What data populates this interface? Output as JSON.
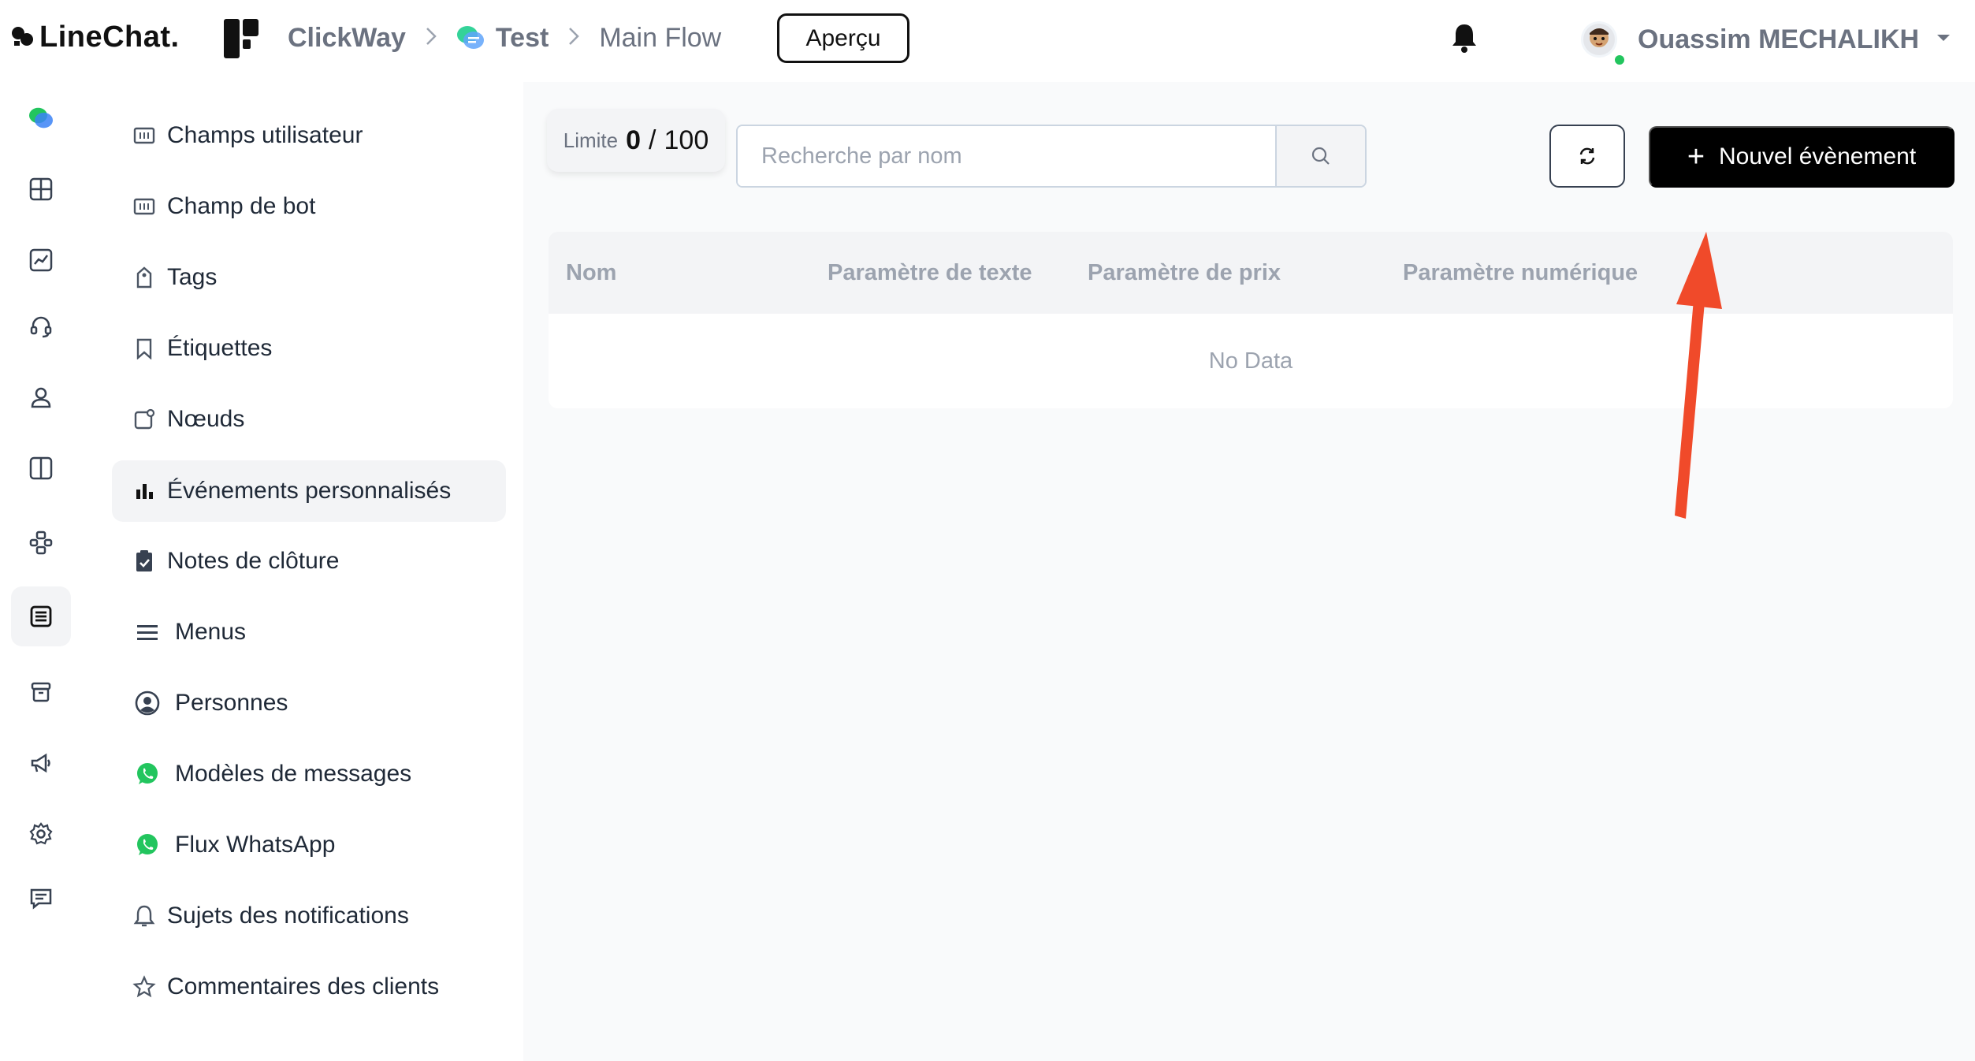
{
  "brand": {
    "name": "LineChat."
  },
  "breadcrumb": {
    "workspace": "ClickWay",
    "bot": "Test",
    "flow": "Main Flow",
    "separator": ">"
  },
  "header": {
    "preview_label": "Aperçu",
    "user_name": "Ouassim MECHALIKH",
    "user_status_color": "#22c55e"
  },
  "rail": {
    "items": [
      "chat-bubbles-icon",
      "dashboard-grid-icon",
      "analytics-chart-icon",
      "headset-icon",
      "user-icon",
      "columns-icon",
      "flow-nodes-icon",
      "content-list-icon",
      "archive-icon",
      "megaphone-icon",
      "settings-icon",
      "message-icon"
    ],
    "active_index": 7
  },
  "sidebar": {
    "items": [
      {
        "label": "Champs utilisateur",
        "icon": "field-icon"
      },
      {
        "label": "Champ de bot",
        "icon": "field-icon"
      },
      {
        "label": "Tags",
        "icon": "tag-icon"
      },
      {
        "label": "Étiquettes",
        "icon": "bookmark-icon"
      },
      {
        "label": "Nœuds",
        "icon": "node-icon"
      },
      {
        "label": "Événements personnalisés",
        "icon": "bar-chart-icon",
        "active": true
      },
      {
        "label": "Notes de clôture",
        "icon": "clipboard-check-icon"
      },
      {
        "label": "Menus",
        "icon": "menu-lines-icon"
      },
      {
        "label": "Personnes",
        "icon": "person-circle-icon"
      },
      {
        "label": "Modèles de messages",
        "icon": "whatsapp-icon"
      },
      {
        "label": "Flux WhatsApp",
        "icon": "whatsapp-icon"
      },
      {
        "label": "Sujets des notifications",
        "icon": "bell-outline-icon"
      },
      {
        "label": "Commentaires des clients",
        "icon": "star-icon"
      }
    ]
  },
  "toolbar": {
    "limit_label": "Limite",
    "limit_current": "0",
    "limit_separator": "/",
    "limit_max": "100",
    "search_placeholder": "Recherche par nom",
    "new_event_label": "Nouvel évènement",
    "new_event_plus": "+"
  },
  "table": {
    "columns": [
      "Nom",
      "Paramètre de texte",
      "Paramètre de prix",
      "Paramètre numérique"
    ],
    "empty_text": "No Data"
  },
  "colors": {
    "accent": "#000000",
    "whatsapp": "#22c55e",
    "annotation_arrow": "#f04a2a"
  }
}
